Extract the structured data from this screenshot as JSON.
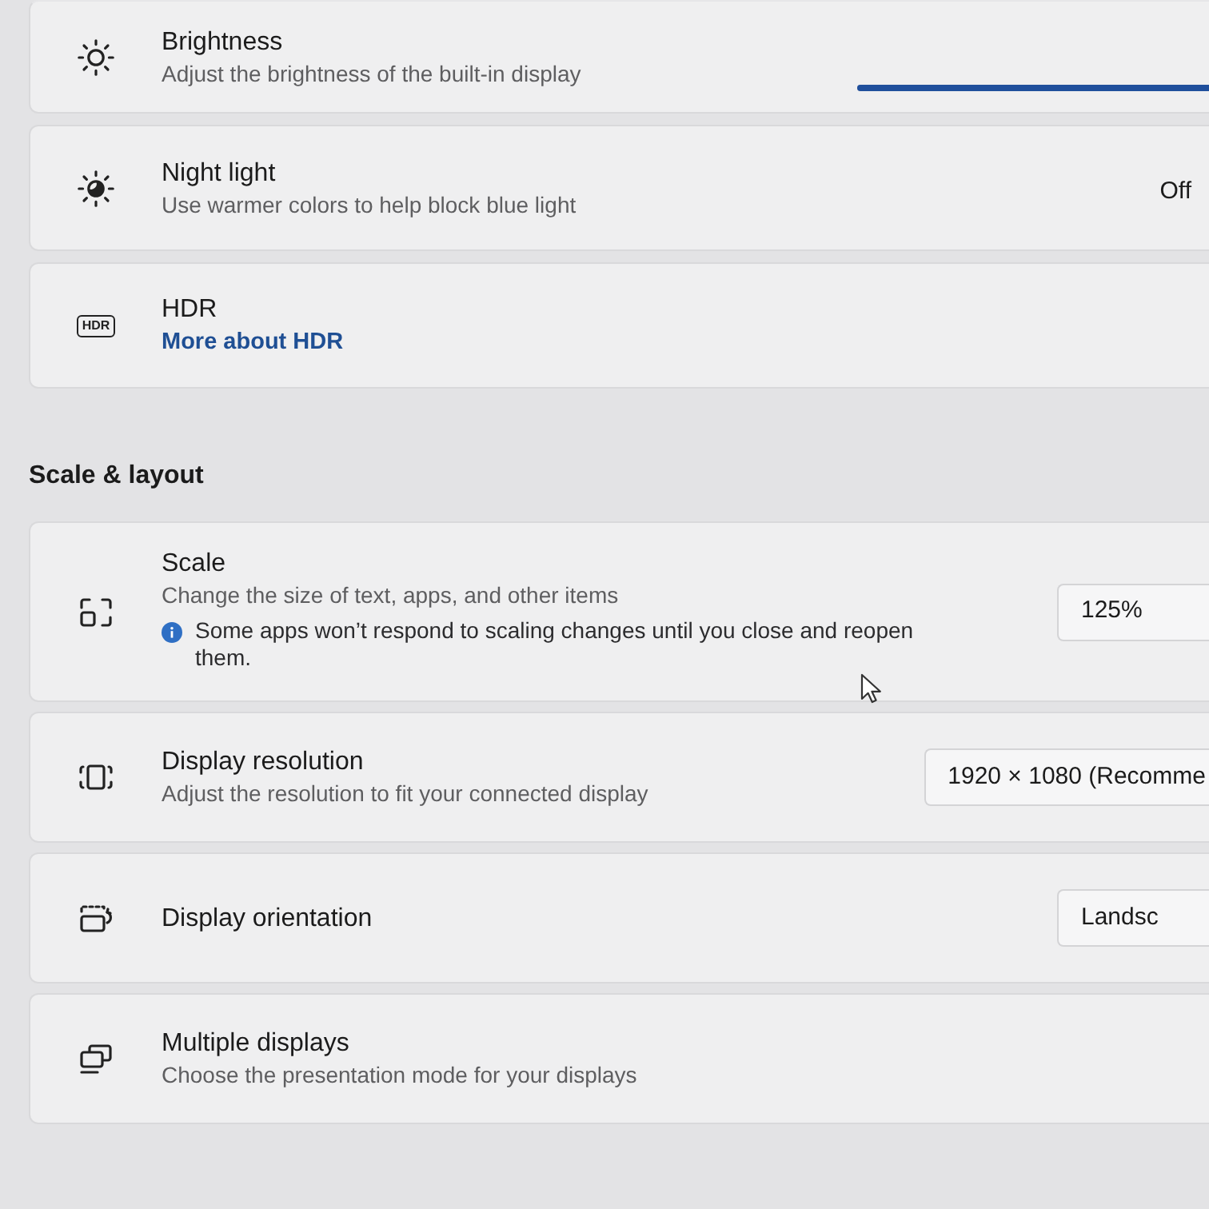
{
  "display_rows": [
    {
      "kind": "slider",
      "title": "Brightness",
      "subtitle": "Adjust the brightness of the built-in display",
      "level": 1
    },
    {
      "kind": "status",
      "title": "Night light",
      "subtitle": "Use warmer colors to help block blue light",
      "status": "Off"
    },
    {
      "kind": "link",
      "icon_text": "HDR",
      "title": "HDR",
      "link": "More about HDR"
    }
  ],
  "scale_layout": {
    "heading": "Scale & layout",
    "rows": [
      {
        "kind": "dropdown",
        "title": "Scale",
        "subtitle": "Change the size of text, apps, and other items",
        "note": "Some apps won’t respond to scaling changes until you close and reopen them.",
        "value": "125%"
      },
      {
        "kind": "dropdown",
        "title": "Display resolution",
        "subtitle": "Adjust the resolution to fit your connected display",
        "value": "1920 × 1080 (Recomme"
      },
      {
        "kind": "dropdown",
        "title": "Display orientation",
        "value": "Landsc"
      },
      {
        "kind": "plain",
        "title": "Multiple displays",
        "subtitle": "Choose the presentation mode for your displays"
      }
    ]
  }
}
